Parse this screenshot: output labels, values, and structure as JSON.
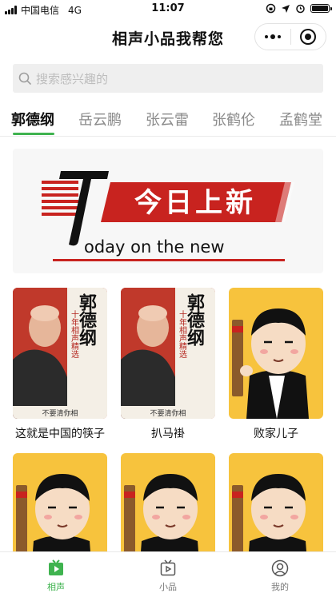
{
  "status_bar": {
    "carrier": "中国电信",
    "network": "4G",
    "time": "11:07"
  },
  "header": {
    "title": "相声小品我帮您",
    "menu_icon": "more-dots-icon",
    "close_icon": "target-icon"
  },
  "search": {
    "placeholder": "搜索感兴趣的"
  },
  "tabs": [
    {
      "label": "郭德纲",
      "active": true
    },
    {
      "label": "岳云鹏",
      "active": false
    },
    {
      "label": "张云雷",
      "active": false
    },
    {
      "label": "张鹤伦",
      "active": false
    },
    {
      "label": "孟鹤堂",
      "active": false
    }
  ],
  "banner": {
    "headline": "今日上新",
    "subline": "oday on the new",
    "big_letter": "T"
  },
  "items": [
    {
      "title": "这就是中国的筷子",
      "thumb": "portrait",
      "poster_text": "郭德纲",
      "poster_sub": "十年相声精选",
      "poster_foot": "不要清你相"
    },
    {
      "title": "扒马褂",
      "thumb": "portrait",
      "poster_text": "郭德纲",
      "poster_sub": "十年相声精选",
      "poster_foot": "不要清你相"
    },
    {
      "title": "败家儿子",
      "thumb": "cartoon",
      "poster_text": "",
      "poster_sub": "",
      "poster_foot": ""
    },
    {
      "title": "",
      "thumb": "cartoon",
      "poster_text": "",
      "poster_sub": "",
      "poster_foot": ""
    },
    {
      "title": "",
      "thumb": "cartoon",
      "poster_text": "",
      "poster_sub": "",
      "poster_foot": ""
    },
    {
      "title": "",
      "thumb": "cartoon",
      "poster_text": "",
      "poster_sub": "",
      "poster_foot": ""
    }
  ],
  "tab_bar": [
    {
      "label": "相声",
      "icon": "play-icon",
      "active": true
    },
    {
      "label": "小品",
      "icon": "video-icon",
      "active": false
    },
    {
      "label": "我的",
      "icon": "user-icon",
      "active": false
    }
  ],
  "colors": {
    "accent": "#3fb34f",
    "banner_red": "#c8231f",
    "poster_yellow": "#f7c33d"
  }
}
